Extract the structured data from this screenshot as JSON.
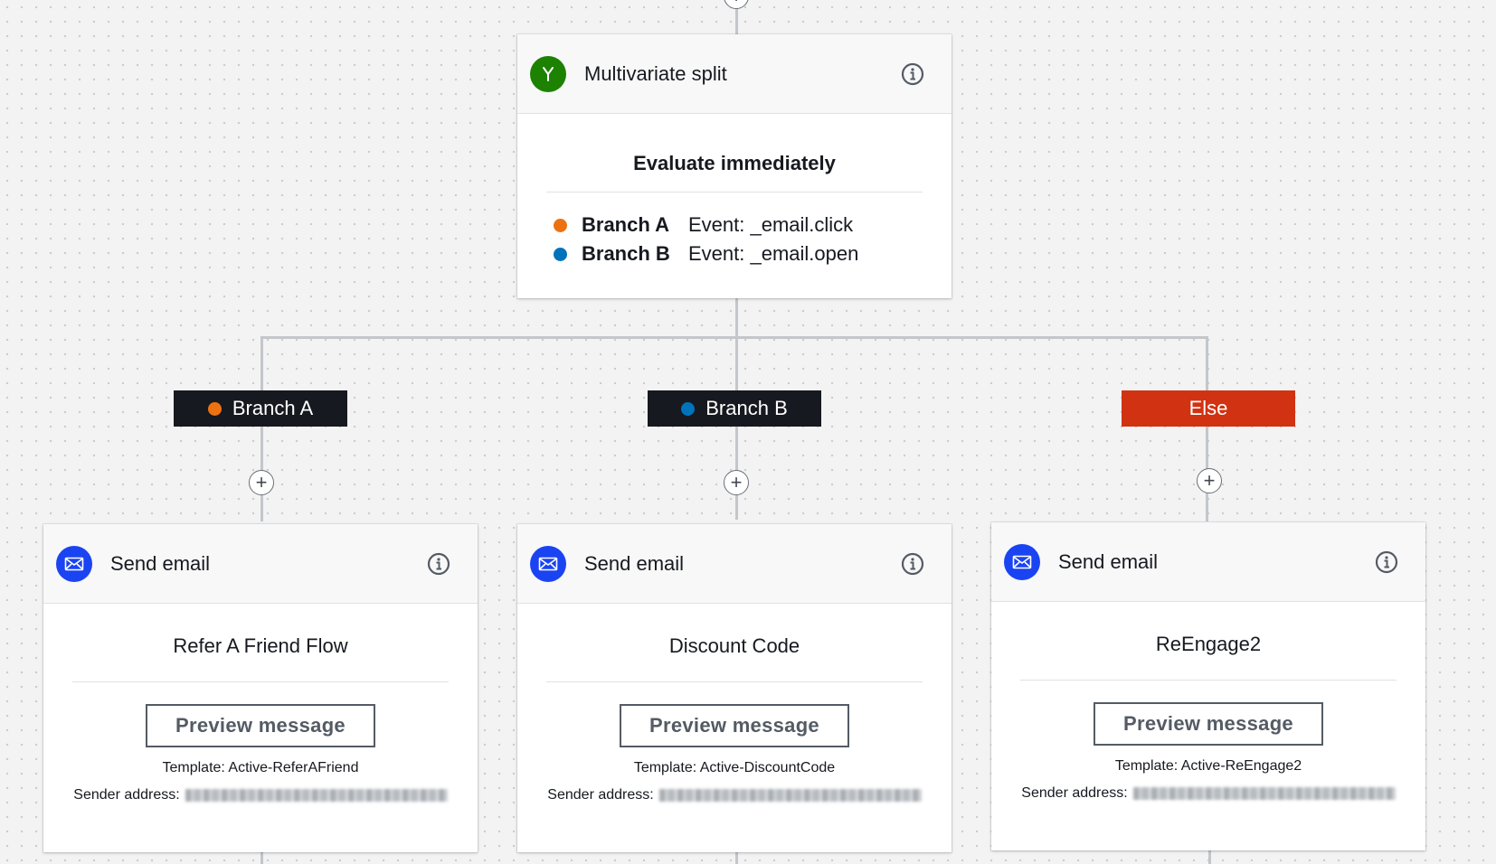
{
  "split": {
    "title": "Multivariate split",
    "subtitle": "Evaluate immediately",
    "branches": [
      {
        "name": "Branch A",
        "event": "Event: _email.click",
        "color": "#ec7211"
      },
      {
        "name": "Branch B",
        "event": "Event: _email.open",
        "color": "#0073bb"
      }
    ]
  },
  "branch_labels": [
    {
      "text": "Branch A",
      "color": "#ec7211"
    },
    {
      "text": "Branch B",
      "color": "#0073bb"
    },
    {
      "text": "Else",
      "bg": "#d13212"
    }
  ],
  "emails": [
    {
      "title": "Send email",
      "subtitle": "Refer A Friend Flow",
      "button": "Preview message",
      "template": "Template: Active-ReferAFriend",
      "sender_label": "Sender address:"
    },
    {
      "title": "Send email",
      "subtitle": "Discount Code",
      "button": "Preview message",
      "template": "Template: Active-DiscountCode",
      "sender_label": "Sender address:"
    },
    {
      "title": "Send email",
      "subtitle": "ReEngage2",
      "button": "Preview message",
      "template": "Template: Active-ReEngage2",
      "sender_label": "Sender address:"
    }
  ],
  "colors": {
    "split_icon": "#1d8102",
    "email_icon": "#1a44f2",
    "label_bg": "#16191f",
    "else_bg": "#d13212"
  },
  "icons": {
    "split": "split-icon",
    "email": "envelope-icon",
    "info": "info-icon",
    "add": "plus-icon"
  }
}
